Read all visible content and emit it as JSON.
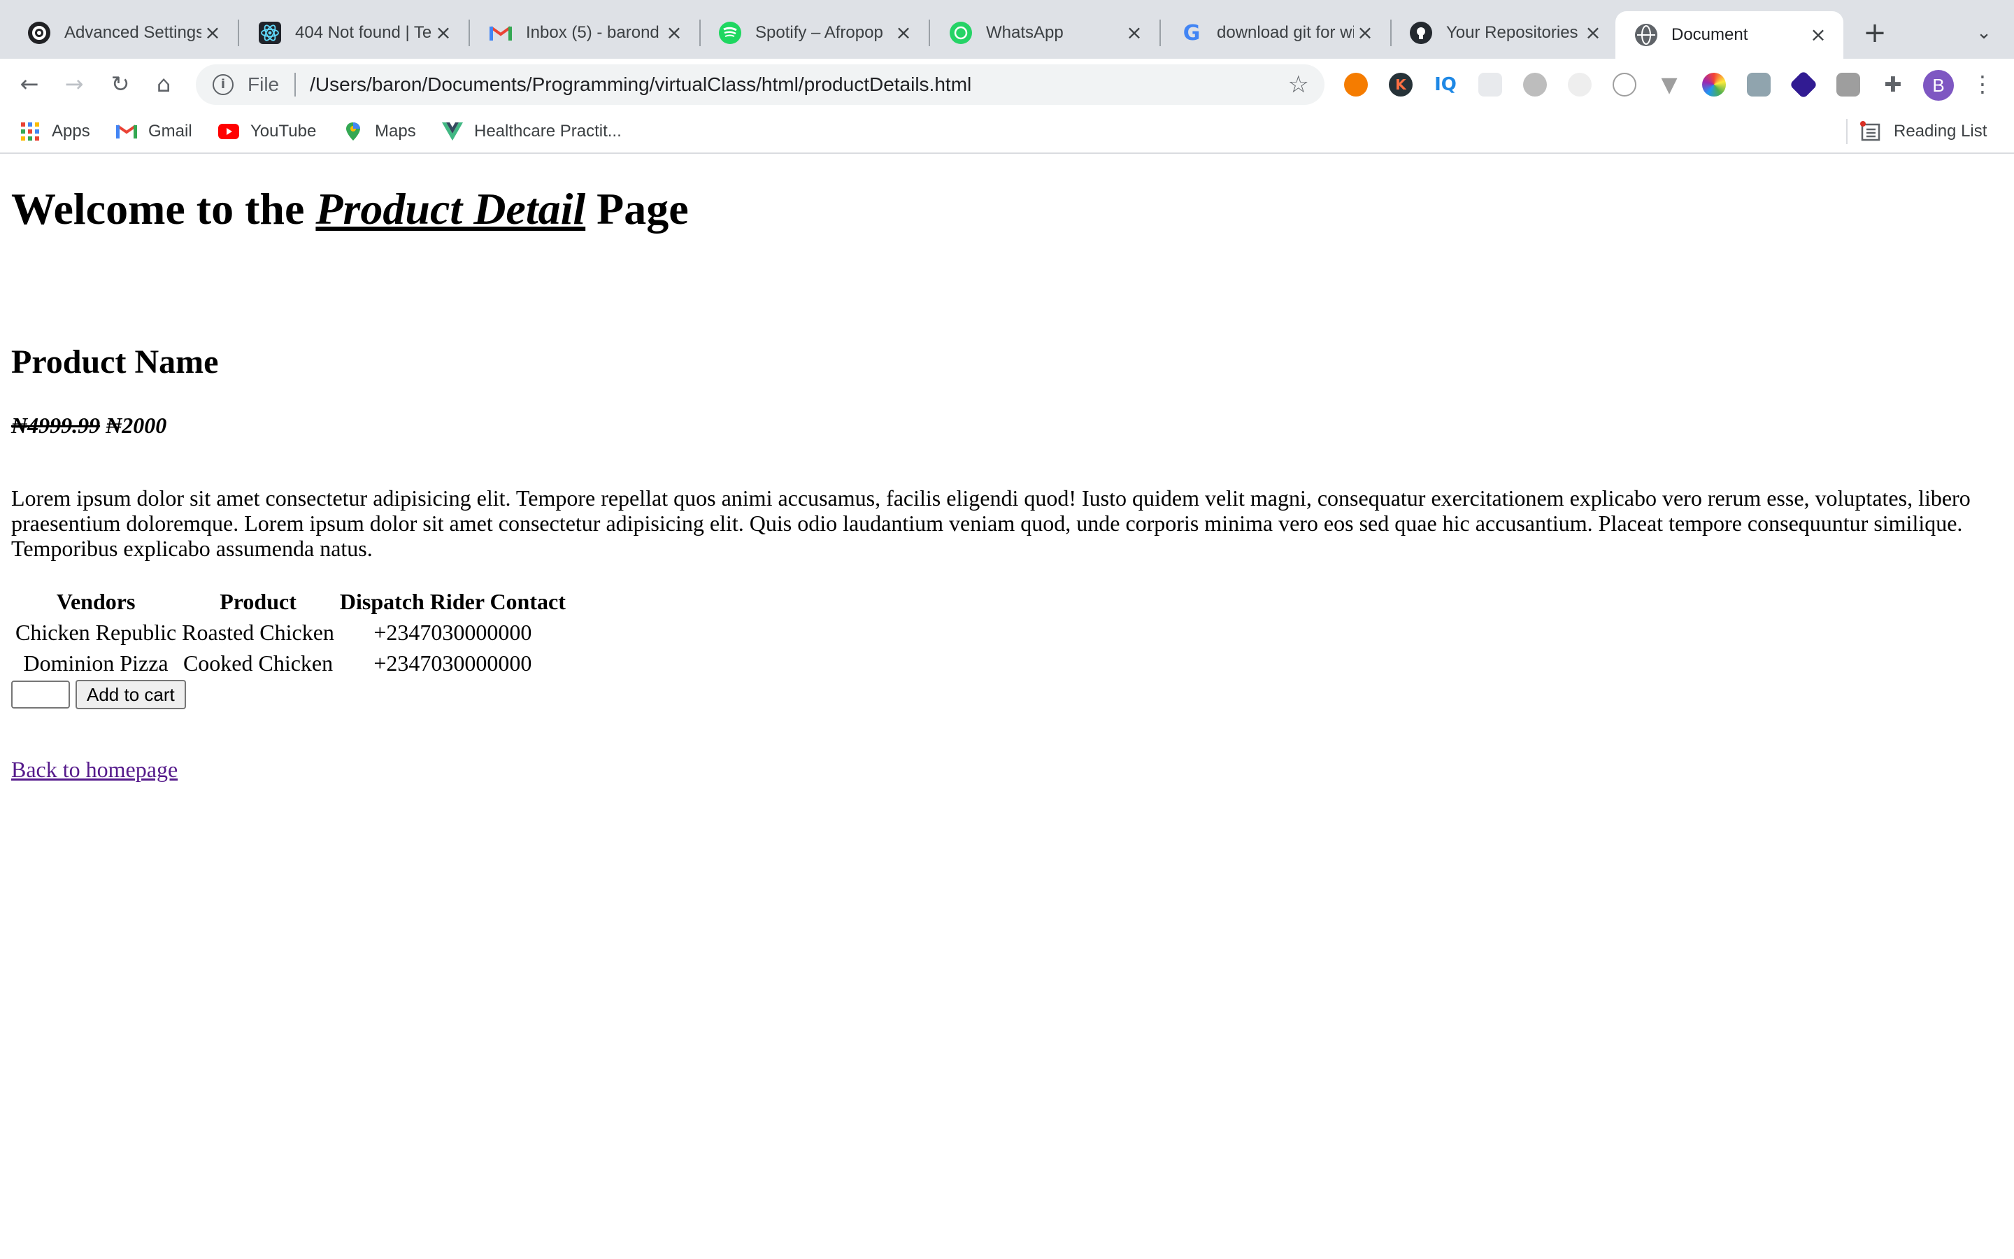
{
  "browser": {
    "tabs": [
      {
        "title": "Advanced Settings",
        "favicon": "gear-logo-icon",
        "active": false
      },
      {
        "title": "404 Not found | Tec",
        "favicon": "react-logo-icon",
        "active": false
      },
      {
        "title": "Inbox (5) - barond",
        "favicon": "gmail-icon",
        "active": false
      },
      {
        "title": "Spotify – Afropop",
        "favicon": "spotify-icon",
        "active": false
      },
      {
        "title": "WhatsApp",
        "favicon": "whatsapp-icon",
        "active": false
      },
      {
        "title": "download git for wi",
        "favicon": "google-icon",
        "active": false
      },
      {
        "title": "Your Repositories",
        "favicon": "github-icon",
        "active": false
      },
      {
        "title": "Document",
        "favicon": "globe-icon",
        "active": true
      }
    ],
    "address": {
      "scheme": "File",
      "url": "/Users/baron/Documents/Programming/virtualClass/html/productDetails.html"
    },
    "profile_initial": "B",
    "bookmarks": [
      {
        "label": "Apps",
        "icon": "apps-grid-icon"
      },
      {
        "label": "Gmail",
        "icon": "gmail-icon"
      },
      {
        "label": "YouTube",
        "icon": "youtube-icon"
      },
      {
        "label": "Maps",
        "icon": "maps-pin-icon"
      },
      {
        "label": "Healthcare Practit...",
        "icon": "vue-logo-icon"
      }
    ],
    "reading_list": "Reading List"
  },
  "page": {
    "title_prefix": "Welcome to the ",
    "title_emphasis": "Product Detail",
    "title_suffix": " Page",
    "product_name": "Product Name",
    "old_price": "₦4999.99",
    "new_price": "₦2000",
    "description": "Lorem ipsum dolor sit amet consectetur adipisicing elit. Tempore repellat quos animi accusamus, facilis eligendi quod! Iusto quidem velit magni, consequatur exercitationem explicabo vero rerum esse, voluptates, libero praesentium doloremque. Lorem ipsum dolor sit amet consectetur adipisicing elit. Quis odio laudantium veniam quod, unde corporis minima vero eos sed quae hic accusantium. Placeat tempore consequuntur similique. Temporibus explicabo assumenda natus.",
    "table": {
      "headers": [
        "Vendors",
        "Product",
        "Dispatch Rider Contact"
      ],
      "rows": [
        [
          "Chicken Republic",
          "Roasted Chicken",
          "+2347030000000"
        ],
        [
          "Dominion Pizza",
          "Cooked Chicken",
          "+2347030000000"
        ]
      ]
    },
    "quantity_value": "",
    "add_to_cart": "Add to cart",
    "back_link": "Back to homepage"
  },
  "colors": {
    "tabstrip_bg": "#dee1e6",
    "link_visited": "#551a8b",
    "profile_bg": "#7e57c2"
  }
}
